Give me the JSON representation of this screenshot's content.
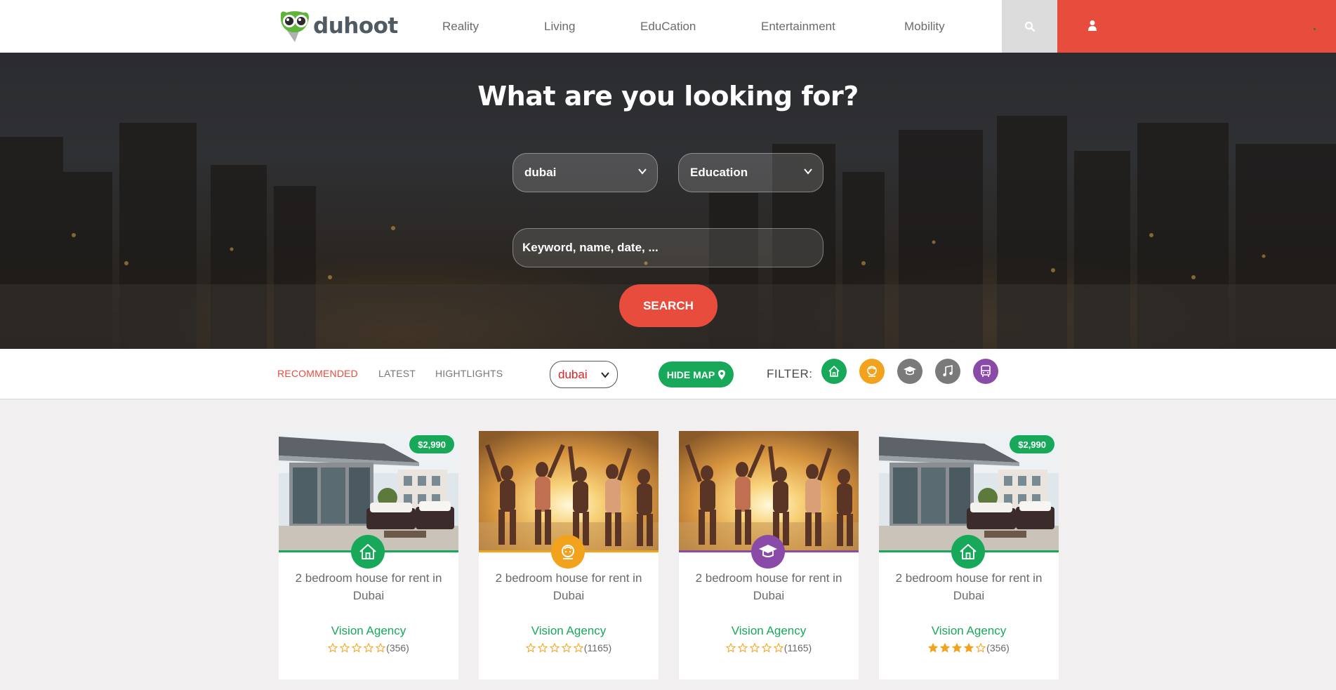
{
  "header": {
    "logo_text": "duhoot",
    "nav": [
      "Reality",
      "Living",
      "EduCation",
      "Entertainment",
      "Mobility"
    ]
  },
  "hero": {
    "title": "What are you looking for?",
    "city_select": "dubai",
    "category_select": "Education",
    "keyword_placeholder": "Keyword, name, date, ...",
    "search_label": "SEARCH"
  },
  "filterbar": {
    "tabs": [
      "RECOMMENDED",
      "LATEST",
      "HIGHTLIGHTS"
    ],
    "active_tab": "RECOMMENDED",
    "city": "dubai",
    "hide_map_label": "HIDE MAP",
    "filter_label": "FILTER:",
    "filters": [
      {
        "name": "home",
        "color": "#17a85a"
      },
      {
        "name": "living",
        "color": "#f2a21c"
      },
      {
        "name": "education",
        "color": "#7a7a7a"
      },
      {
        "name": "music",
        "color": "#7a7a7a"
      },
      {
        "name": "bus",
        "color": "#8a4aa8"
      }
    ]
  },
  "colors": {
    "accent_red": "#e84c3d",
    "green": "#17a85a",
    "orange": "#f2a21c",
    "purple": "#8a4aa8"
  },
  "cards": [
    {
      "image": "house",
      "price": "$2,990",
      "category": "home-icon",
      "cat_color": "#17a85a",
      "title": "2 bedroom house for rent in Dubai",
      "agency": "Vision Agency",
      "rating": 0,
      "reviews": "(356)"
    },
    {
      "image": "party",
      "price": "",
      "category": "living-icon",
      "cat_color": "#f2a21c",
      "title": "2 bedroom house for rent in Dubai",
      "agency": "Vision Agency",
      "rating": 0,
      "reviews": "(1165)"
    },
    {
      "image": "party",
      "price": "",
      "category": "education-icon",
      "cat_color": "#8a4aa8",
      "title": "2 bedroom house for rent in Dubai",
      "agency": "Vision Agency",
      "rating": 0,
      "reviews": "(1165)"
    },
    {
      "image": "house",
      "price": "$2,990",
      "category": "home-icon",
      "cat_color": "#17a85a",
      "title": "2 bedroom house for rent in Dubai",
      "agency": "Vision Agency",
      "rating": 4,
      "reviews": "(356)"
    }
  ]
}
